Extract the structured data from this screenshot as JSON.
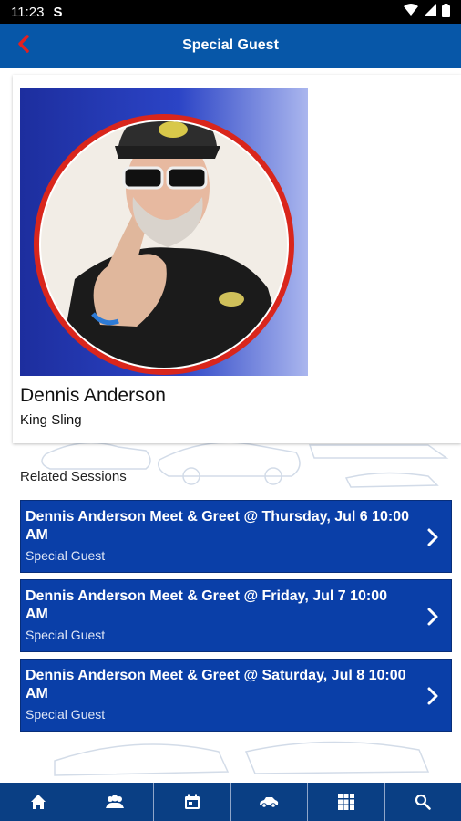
{
  "status_bar": {
    "time": "11:23",
    "carrier_glyph": "S"
  },
  "app_bar": {
    "title": "Special Guest",
    "back_icon": "chevron-left-icon"
  },
  "guest": {
    "name": "Dennis Anderson",
    "subtitle": "King Sling"
  },
  "related": {
    "heading": "Related Sessions",
    "sessions": [
      {
        "title": "Dennis Anderson Meet & Greet @ Thursday, Jul 6 10:00 AM",
        "subtitle": "Special Guest"
      },
      {
        "title": "Dennis Anderson Meet & Greet @ Friday, Jul 7 10:00 AM",
        "subtitle": "Special Guest"
      },
      {
        "title": "Dennis Anderson Meet & Greet @ Saturday, Jul 8 10:00 AM",
        "subtitle": "Special Guest"
      }
    ]
  },
  "bottom_nav": [
    "home-icon",
    "people-icon",
    "calendar-icon",
    "car-icon",
    "grid-icon",
    "search-icon"
  ],
  "colors": {
    "app_bar": "#0757a8",
    "session_card": "#0a3fa8",
    "bottom_nav": "#0a3f84",
    "back_arrow": "#e32020"
  }
}
